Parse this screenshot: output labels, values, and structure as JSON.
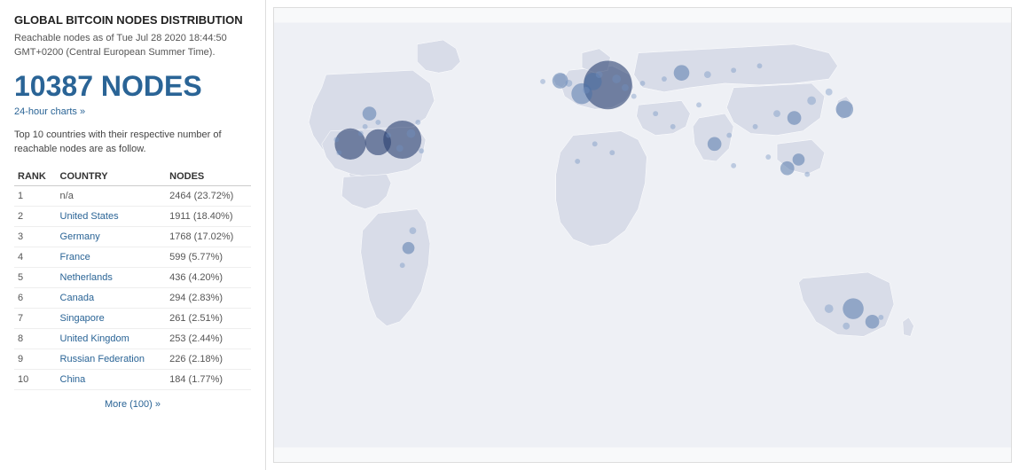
{
  "header": {
    "title": "GLOBAL BITCOIN NODES DISTRIBUTION",
    "subtitle": "Reachable nodes as of Tue Jul 28 2020 18:44:50 GMT+0200 (Central European Summer Time)."
  },
  "stats": {
    "nodes_count": "10387 NODES",
    "chart_link": "24-hour charts »"
  },
  "description": "Top 10 countries with their respective number of reachable nodes are as follow.",
  "table": {
    "headers": [
      "RANK",
      "COUNTRY",
      "NODES"
    ],
    "rows": [
      {
        "rank": "1",
        "country": "n/a",
        "nodes": "2464 (23.72%)",
        "link": false
      },
      {
        "rank": "2",
        "country": "United States",
        "nodes": "1911 (18.40%)",
        "link": true
      },
      {
        "rank": "3",
        "country": "Germany",
        "nodes": "1768 (17.02%)",
        "link": true
      },
      {
        "rank": "4",
        "country": "France",
        "nodes": "599 (5.77%)",
        "link": true
      },
      {
        "rank": "5",
        "country": "Netherlands",
        "nodes": "436 (4.20%)",
        "link": true
      },
      {
        "rank": "6",
        "country": "Canada",
        "nodes": "294 (2.83%)",
        "link": true
      },
      {
        "rank": "7",
        "country": "Singapore",
        "nodes": "261 (2.51%)",
        "link": true
      },
      {
        "rank": "8",
        "country": "United Kingdom",
        "nodes": "253 (2.44%)",
        "link": true
      },
      {
        "rank": "9",
        "country": "Russian Federation",
        "nodes": "226 (2.18%)",
        "link": true
      },
      {
        "rank": "10",
        "country": "China",
        "nodes": "184 (1.77%)",
        "link": true
      }
    ],
    "more_link": "More (100) »"
  }
}
